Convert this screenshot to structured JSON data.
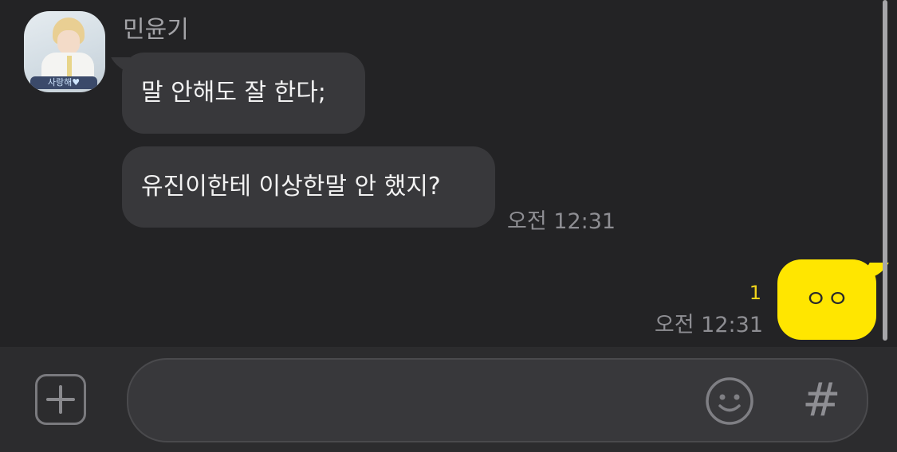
{
  "chat": {
    "sender_name": "민윤기",
    "avatar_caption": "사랑해♥",
    "messages_in": [
      {
        "text": "말 안해도 잘 한다;"
      },
      {
        "text": "유진이한테 이상한말 안 했지?"
      }
    ],
    "in_time": "오전 12:31",
    "message_out": {
      "text": "ㅇㅇ",
      "read_count": "1",
      "time": "오전 12:31"
    }
  },
  "input_bar": {
    "message_value": "",
    "placeholder": "",
    "hash_label": "#"
  },
  "icons": {
    "attach": "plus-icon",
    "emoji": "smiley-icon",
    "hashtag": "hash-icon"
  },
  "colors": {
    "background": "#232325",
    "bubble_in": "#38383b",
    "bubble_out": "#ffe600",
    "read_count": "#f2d41a",
    "timestamp": "#8e8e93"
  }
}
